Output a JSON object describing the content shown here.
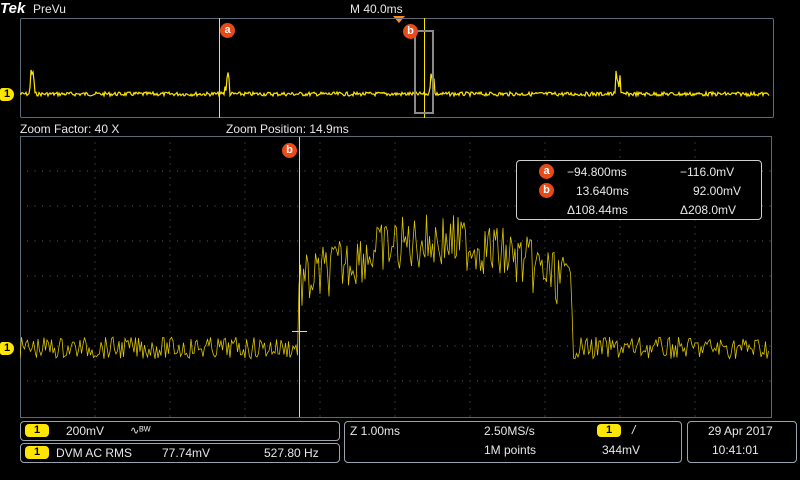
{
  "header": {
    "brand": "Tek",
    "mode": "PreVu",
    "timebase": "M 40.0ms"
  },
  "zoom": {
    "factor_label": "Zoom Factor: 40 X",
    "position_label": "Zoom Position: 14.9ms"
  },
  "markers": {
    "a": "a",
    "b": "b",
    "ch1": "1"
  },
  "cursor_readout": {
    "a_time": "−94.800ms",
    "a_volt": "−116.0mV",
    "b_time": "13.640ms",
    "b_volt": "92.00mV",
    "delta_time": "Δ108.44ms",
    "delta_volt": "Δ208.0mV"
  },
  "status": {
    "ch_scale": "200mV",
    "bw_symbol": "∿ᴮᵂ",
    "dvm_label": "DVM AC RMS",
    "dvm_value": "77.74mV",
    "dvm_freq": "527.80 Hz",
    "horiz_scale": "Z 1.00ms",
    "sample_rate": "2.50MS/s",
    "record_length": "1M points",
    "trigger_slope": "/",
    "trigger_level": "344mV",
    "date": "29 Apr  2017",
    "time": "10:41:01"
  },
  "colors": {
    "trace": "#ffe600",
    "marker": "#e84a1a",
    "frame": "#9aa4b0",
    "cursor": "#ffe600"
  }
}
